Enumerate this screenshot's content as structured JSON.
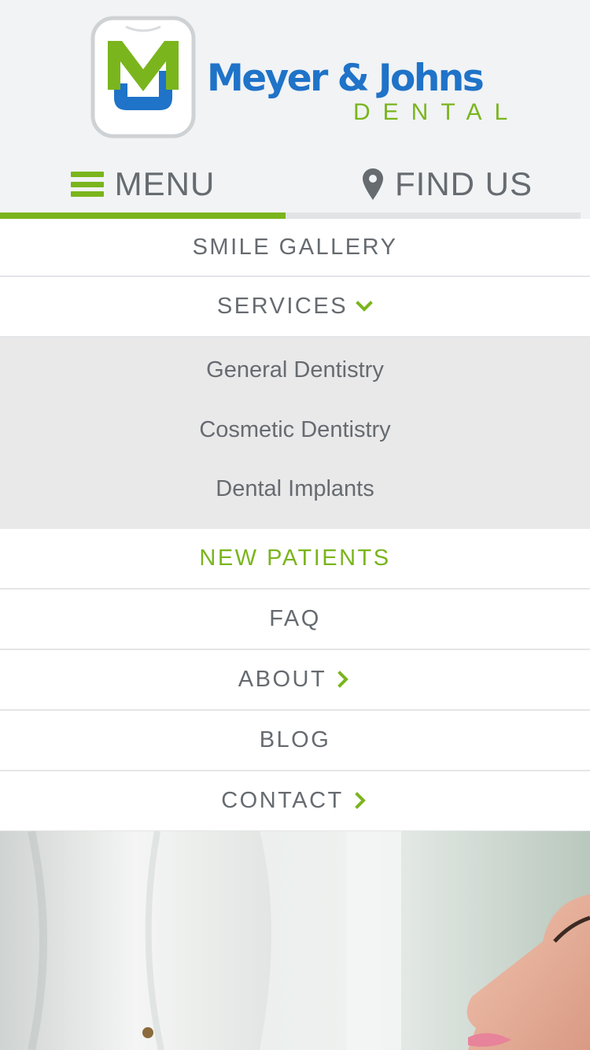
{
  "brand": {
    "name": "Meyer & Johns",
    "subtitle": "DENTAL",
    "primary_color": "#1f73c8",
    "accent_color": "#7ab51d"
  },
  "header": {
    "menu_label": "MENU",
    "menu_icon": "hamburger-icon",
    "find_label": "FIND US",
    "find_icon": "map-pin-icon",
    "active_tab": "menu"
  },
  "nav": {
    "smile_gallery": "SMILE GALLERY",
    "services": "SERVICES",
    "services_icon": "chevron-down-icon",
    "sub": {
      "general": "General Dentistry",
      "cosmetic": "Cosmetic Dentistry",
      "implants": "Dental Implants"
    },
    "new_patients": "NEW PATIENTS",
    "faq": "FAQ",
    "about": "ABOUT",
    "about_icon": "chevron-right-icon",
    "blog": "BLOG",
    "contact": "CONTACT",
    "contact_icon": "chevron-right-icon"
  },
  "colors": {
    "header_bg": "#f1f3f5",
    "text_gray": "#666b70",
    "submenu_bg": "#e9e9ea",
    "divider": "#e4e5e7"
  }
}
